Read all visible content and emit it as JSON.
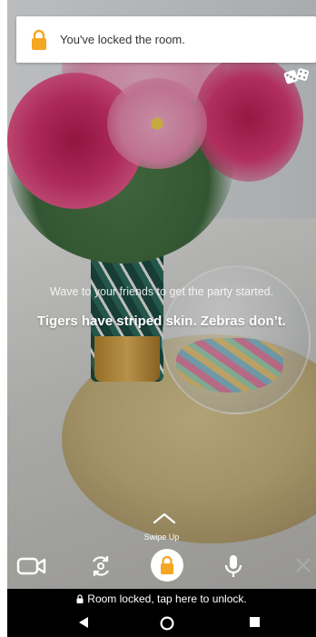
{
  "notification": {
    "text": "You've locked the room.",
    "icon": "lock-icon",
    "lock_color": "#F5A623"
  },
  "top_right": {
    "icon": "dice-icon"
  },
  "stage": {
    "hint": "Wave to your friends to get the party started.",
    "fact": "Tigers have striped skin. Zebras don’t."
  },
  "swipe": {
    "icon": "chevron-up-icon",
    "label": "Swipe Up"
  },
  "controls": {
    "video": {
      "icon": "video-camera-icon"
    },
    "flip": {
      "icon": "camera-flip-icon"
    },
    "lock": {
      "icon": "lock-icon",
      "color": "#F5A623"
    },
    "mic": {
      "icon": "microphone-icon"
    },
    "close": {
      "icon": "close-icon"
    }
  },
  "unlock_bar": {
    "text": "Room locked, tap here to unlock.",
    "icon": "lock-icon"
  },
  "navbar": {
    "back": "back-triangle-icon",
    "home": "home-circle-icon",
    "recent": "recent-apps-square-icon"
  }
}
